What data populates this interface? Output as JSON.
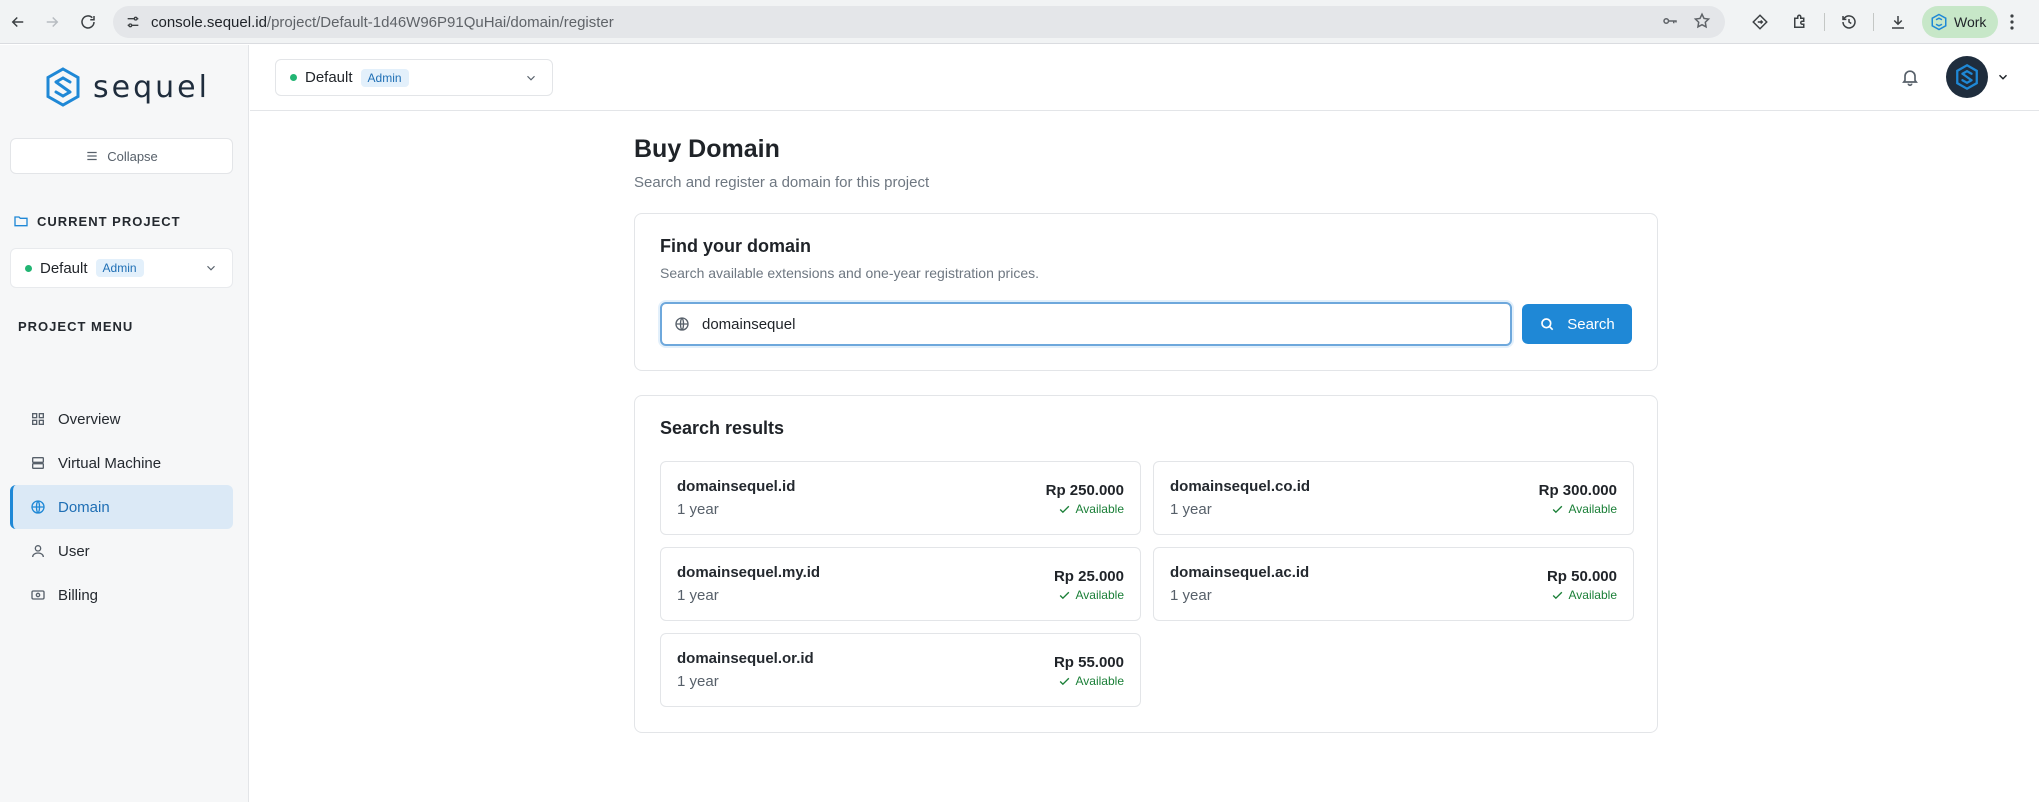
{
  "browser": {
    "url_host": "console.sequel.id",
    "url_path": "/project/Default-1d46W96P91QuHai/domain/register",
    "profile_label": "Work"
  },
  "sidebar": {
    "logo_text": "sequel",
    "collapse_label": "Collapse",
    "current_project_heading": "CURRENT PROJECT",
    "project_name": "Default",
    "project_role": "Admin",
    "project_menu_heading": "PROJECT MENU",
    "items": [
      {
        "label": "Overview",
        "icon": "grid-icon"
      },
      {
        "label": "Virtual Machine",
        "icon": "server-icon"
      },
      {
        "label": "Domain",
        "icon": "globe-icon",
        "active": true
      },
      {
        "label": "User",
        "icon": "user-icon"
      },
      {
        "label": "Billing",
        "icon": "billing-icon"
      }
    ]
  },
  "topbar": {
    "project_name": "Default",
    "project_role": "Admin"
  },
  "main": {
    "title": "Buy Domain",
    "subtitle": "Search and register a domain for this project",
    "find": {
      "title": "Find your domain",
      "subtitle": "Search available extensions and one-year registration prices.",
      "query": "domainsequel",
      "search_label": "Search"
    },
    "results": {
      "title": "Search results",
      "items": [
        {
          "domain": "domainsequel.id",
          "term": "1 year",
          "price": "Rp 250.000",
          "status": "Available"
        },
        {
          "domain": "domainsequel.co.id",
          "term": "1 year",
          "price": "Rp 300.000",
          "status": "Available"
        },
        {
          "domain": "domainsequel.my.id",
          "term": "1 year",
          "price": "Rp 25.000",
          "status": "Available"
        },
        {
          "domain": "domainsequel.ac.id",
          "term": "1 year",
          "price": "Rp 50.000",
          "status": "Available"
        },
        {
          "domain": "domainsequel.or.id",
          "term": "1 year",
          "price": "Rp 55.000",
          "status": "Available"
        }
      ]
    }
  },
  "colors": {
    "accent": "#1f88d6",
    "available": "#1a7f37",
    "status_dot": "#22b573"
  }
}
